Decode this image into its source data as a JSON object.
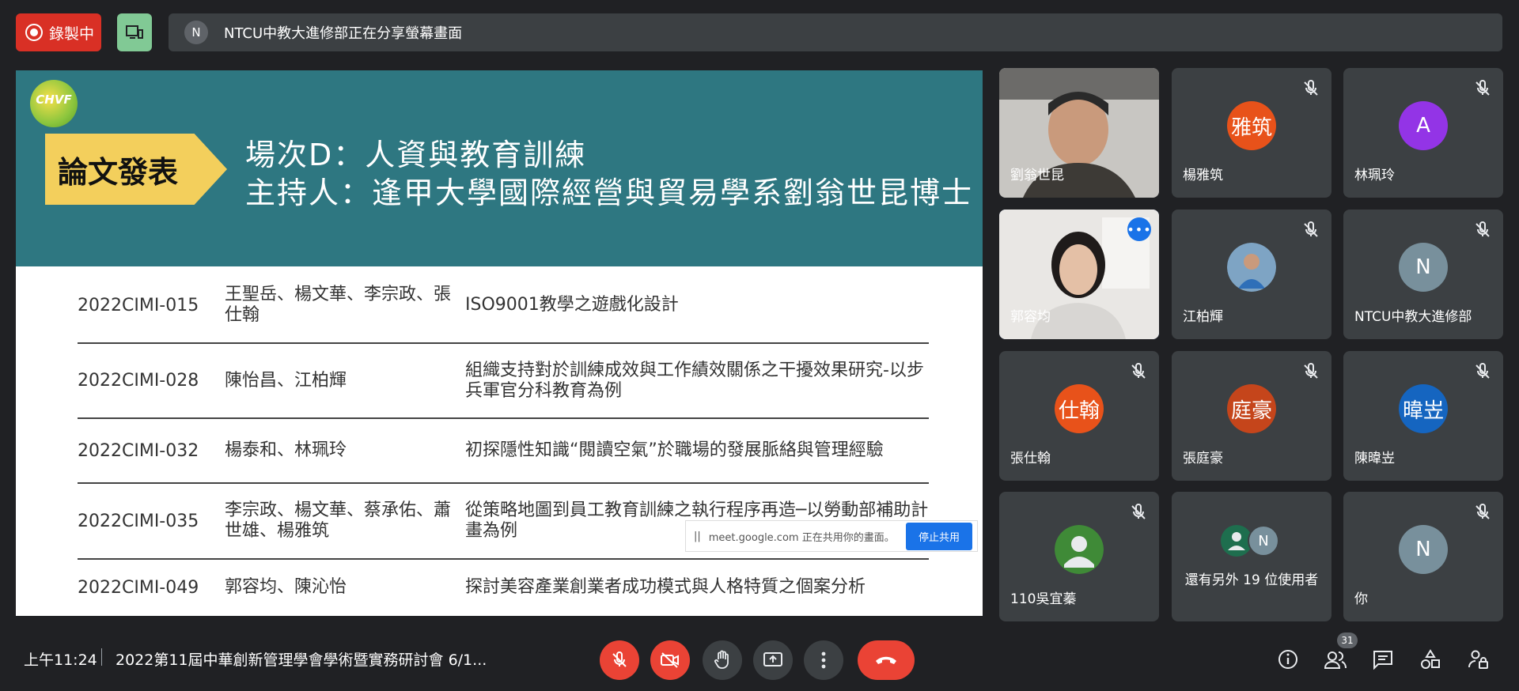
{
  "topbar": {
    "recording_label": "錄製中",
    "presenter_initial": "N",
    "share_text": "NTCU中教大進修部正在分享螢幕畫面"
  },
  "slide": {
    "logo_text": "CHVF",
    "tag": "論文發表",
    "session": "場次D：人資與教育訓練",
    "host": "主持人：逢甲大學國際經營與貿易學系劉翁世昆博士",
    "rows": [
      {
        "id": "2022CIMI-015",
        "authors": "王聖岳、楊文華、李宗政、張仕翰",
        "title": "ISO9001教學之遊戲化設計"
      },
      {
        "id": "2022CIMI-028",
        "authors": "陳怡昌、江柏輝",
        "title": "組織支持對於訓練成效與工作績效關係之干擾效果研究-以步兵軍官分科教育為例"
      },
      {
        "id": "2022CIMI-032",
        "authors": "楊泰和、林珮玲",
        "title": "初探隱性知識“閱讀空氣”於職場的發展脈絡與管理經驗"
      },
      {
        "id": "2022CIMI-035",
        "authors": "李宗政、楊文華、蔡承佑、蕭世雄、楊雅筑",
        "title": "從策略地圖到員工教育訓練之執行程序再造─以勞動部補助計畫為例"
      },
      {
        "id": "2022CIMI-049",
        "authors": "郭容均、陳沁怡",
        "title": "探討美容產業創業者成功模式與人格特質之個案分析"
      }
    ],
    "chrome_notice": "meet.google.com 正在共用你的畫面。",
    "stop_share": "停止共用"
  },
  "participants": [
    {
      "name": "劉翁世昆",
      "type": "video",
      "avatar": ""
    },
    {
      "name": "楊雅筑",
      "type": "avatar",
      "avatar": "雅筑",
      "color": "#e8521a"
    },
    {
      "name": "林珮玲",
      "type": "avatar",
      "avatar": "A",
      "color": "#9334e6"
    },
    {
      "name": "郭容均",
      "type": "video",
      "avatar": ""
    },
    {
      "name": "江柏輝",
      "type": "photo",
      "avatar": ""
    },
    {
      "name": "NTCU中教大進修部",
      "type": "avatar",
      "avatar": "N",
      "color": "#78909c"
    },
    {
      "name": "張仕翰",
      "type": "avatar",
      "avatar": "仕翰",
      "color": "#e8521a"
    },
    {
      "name": "張庭豪",
      "type": "avatar",
      "avatar": "庭豪",
      "color": "#c5451b"
    },
    {
      "name": "陳暐岦",
      "type": "avatar",
      "avatar": "暐岦",
      "color": "#1565c0"
    },
    {
      "name": "110吳宜蓁",
      "type": "person",
      "avatar": ""
    },
    {
      "name": "還有另外 19 位使用者",
      "type": "group",
      "avatar": "N"
    },
    {
      "name": "你",
      "type": "avatar",
      "avatar": "N",
      "color": "#78909c"
    }
  ],
  "bottombar": {
    "time": "上午11:24",
    "meeting_title": "2022第11屆中華創新管理學會學術暨實務研討會 6/1...",
    "people_count": "31"
  }
}
